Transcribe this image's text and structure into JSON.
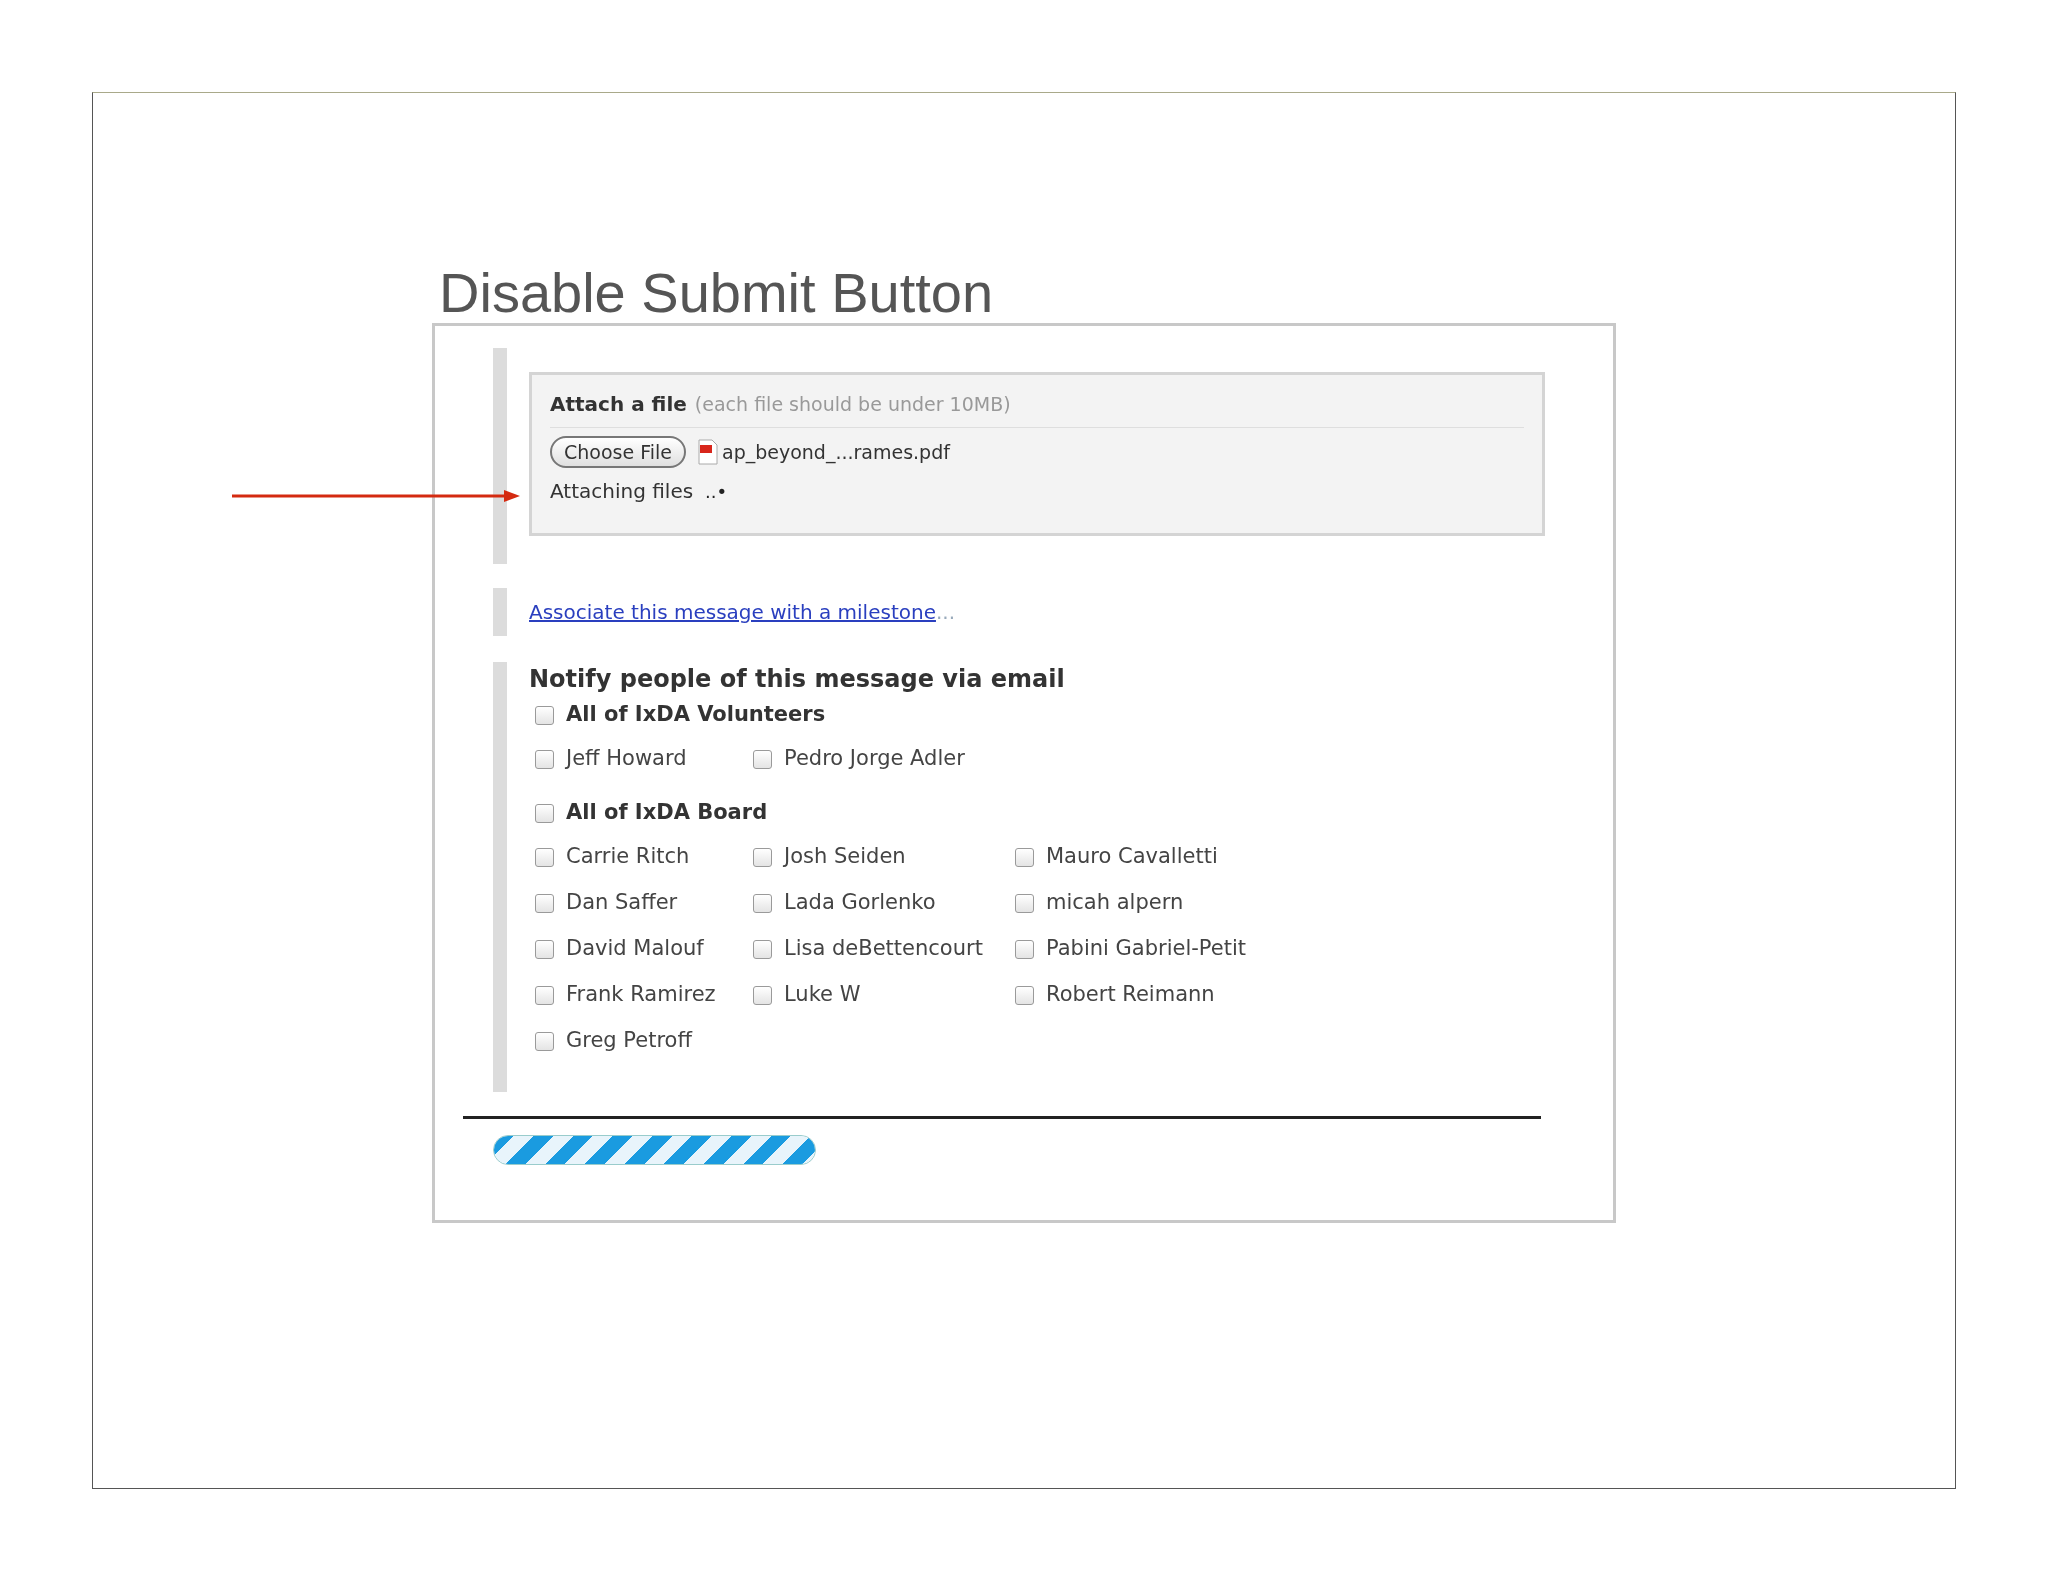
{
  "slide": {
    "title": "Disable Submit Button"
  },
  "attach": {
    "label": "Attach a file",
    "hint": "(each file should be under 10MB)",
    "button": "Choose File",
    "file_name": "ap_beyond_...rames.pdf",
    "status": "Attaching files",
    "status_dots": "..•"
  },
  "progress": {
    "level": 1
  },
  "milestone_link": {
    "text": "Associate this message with a milestone",
    "suffix": "..."
  },
  "notify": {
    "heading": "Notify people of this message via email",
    "groups": [
      {
        "all": {
          "label": "All of IxDA Volunteers",
          "checked": false
        },
        "members": [
          {
            "label": "Jeff Howard",
            "checked": false
          },
          {
            "label": "Pedro Jorge Adler",
            "checked": false
          }
        ]
      },
      {
        "all": {
          "label": "All of IxDA Board",
          "checked": false
        },
        "members": [
          {
            "label": "Carrie Ritch",
            "checked": false
          },
          {
            "label": "Josh Seiden",
            "checked": false
          },
          {
            "label": "Mauro Cavalletti",
            "checked": false
          },
          {
            "label": "Dan Saffer",
            "checked": false
          },
          {
            "label": "Lada Gorlenko",
            "checked": false
          },
          {
            "label": "micah alpern",
            "checked": false
          },
          {
            "label": "David Malouf",
            "checked": false
          },
          {
            "label": "Lisa deBettencourt",
            "checked": false
          },
          {
            "label": "Pabini Gabriel-Petit",
            "checked": false
          },
          {
            "label": "Frank Ramirez",
            "checked": false
          },
          {
            "label": "Luke W",
            "checked": false
          },
          {
            "label": "Robert Reimann",
            "checked": false
          },
          {
            "label": "Greg Petroff",
            "checked": false
          }
        ]
      }
    ]
  }
}
